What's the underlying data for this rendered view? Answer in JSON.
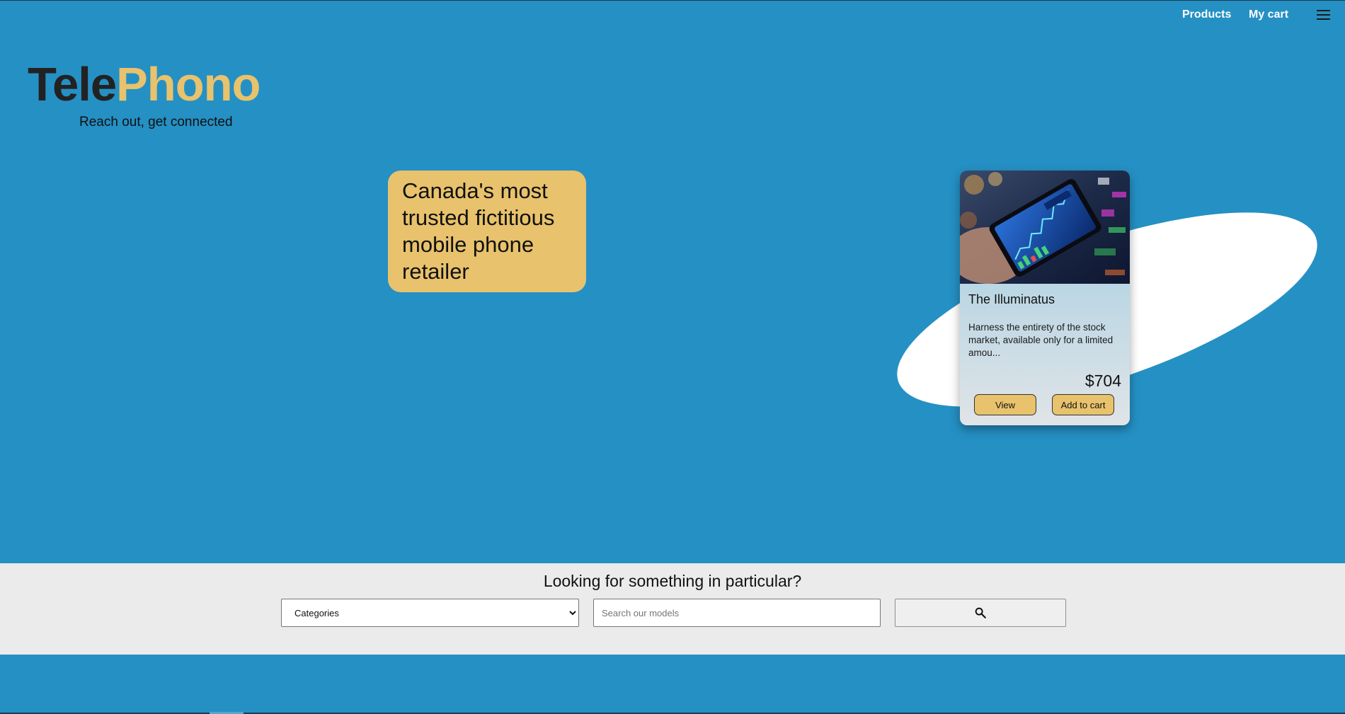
{
  "nav": {
    "products_label": "Products",
    "cart_label": "My cart",
    "menu_icon": "hamburger-menu-icon"
  },
  "brand": {
    "name_part1": "Tele",
    "name_part2": "Phono",
    "tagline": "Reach out, get connected",
    "colors": {
      "dark": "#222222",
      "gold": "#e8c26c"
    }
  },
  "hero": {
    "badge_text": "Canada's most trusted fictitious mobile phone retailer"
  },
  "featured_product": {
    "title": "The Illuminatus",
    "description": "Harness the entirety of the stock market, available only for a limited amou...",
    "price": "$704",
    "view_label": "View",
    "add_to_cart_label": "Add to cart"
  },
  "search": {
    "heading": "Looking for something in particular?",
    "category_selected": "Categories",
    "input_placeholder": "Search our models",
    "input_value": "",
    "button_icon": "search-icon"
  },
  "colors": {
    "background": "#2590c4",
    "accent": "#e8c26c",
    "search_bar_bg": "#ebebeb"
  }
}
